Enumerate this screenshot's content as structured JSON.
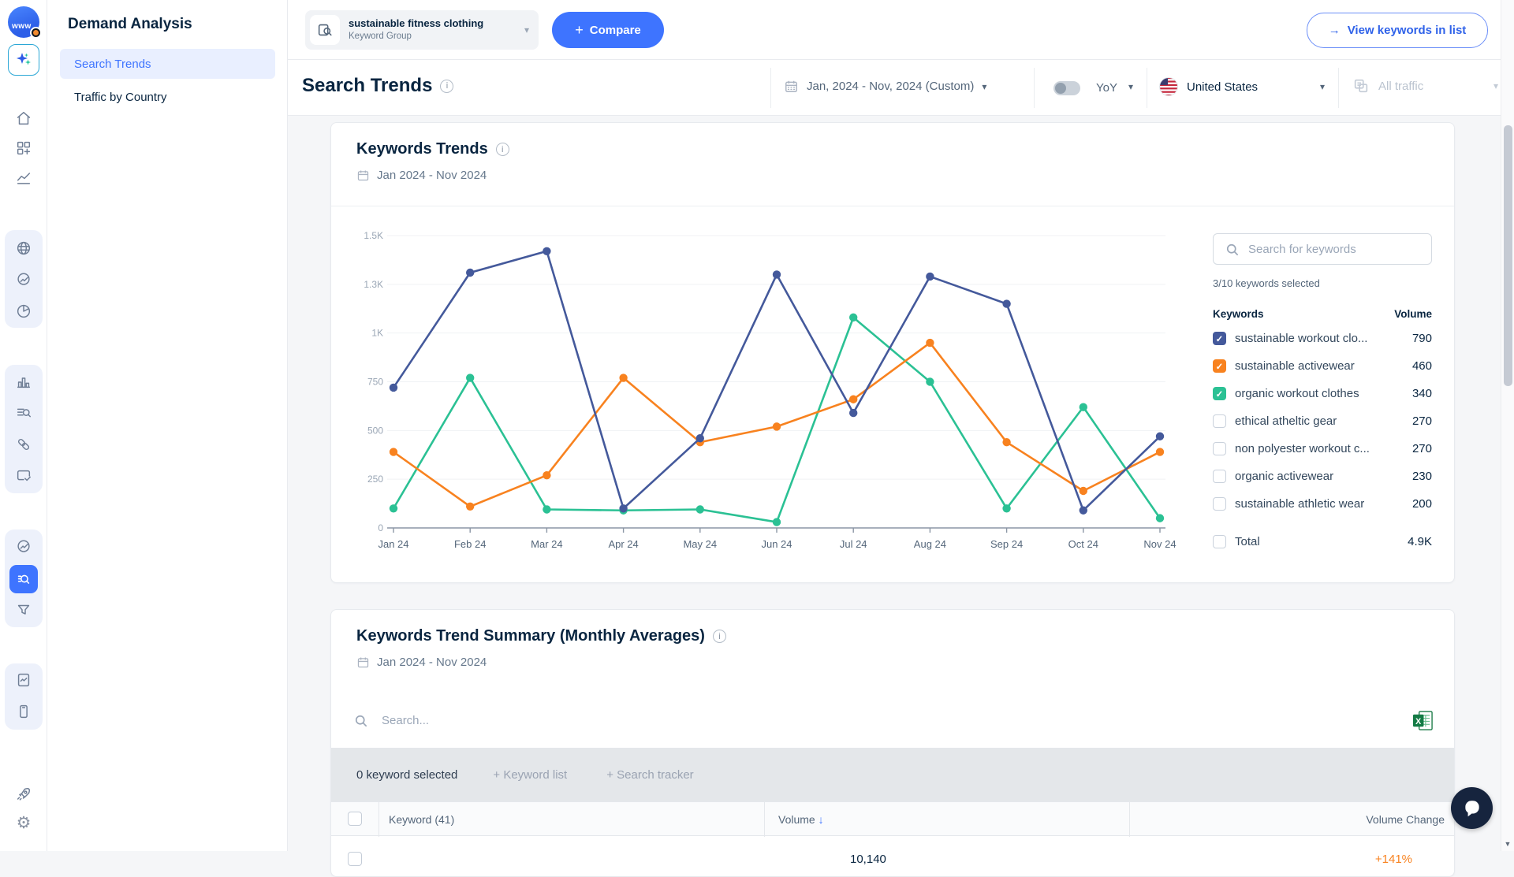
{
  "sidebar": {
    "title": "Demand Analysis",
    "items": [
      {
        "label": "Search Trends",
        "active": true
      },
      {
        "label": "Traffic by Country",
        "active": false
      }
    ]
  },
  "topbar": {
    "group_selector": {
      "name": "sustainable fitness clothing",
      "type": "Keyword Group"
    },
    "compare_label": "Compare",
    "view_keywords_label": "View keywords in list"
  },
  "header": {
    "title": "Search Trends",
    "filters": {
      "date_range": "Jan, 2024 - Nov, 2024 (Custom)",
      "yoy_label": "YoY",
      "country": "United States",
      "traffic": "All traffic"
    }
  },
  "trends_card": {
    "title": "Keywords Trends",
    "date_range": "Jan 2024 - Nov 2024",
    "search_placeholder": "Search for keywords",
    "selected_note": "3/10 keywords selected",
    "col_keywords": "Keywords",
    "col_volume": "Volume",
    "keywords": [
      {
        "label": "sustainable workout clo...",
        "volume": "790",
        "checked": true,
        "color": "#44599B"
      },
      {
        "label": "sustainable activewear",
        "volume": "460",
        "checked": true,
        "color": "#F8821F"
      },
      {
        "label": "organic workout clothes",
        "volume": "340",
        "checked": true,
        "color": "#2BC194"
      },
      {
        "label": "ethical atheltic gear",
        "volume": "270",
        "checked": false,
        "color": null
      },
      {
        "label": "non polyester workout c...",
        "volume": "270",
        "checked": false,
        "color": null
      },
      {
        "label": "organic activewear",
        "volume": "230",
        "checked": false,
        "color": null
      },
      {
        "label": "sustainable athletic wear",
        "volume": "200",
        "checked": false,
        "color": null
      }
    ],
    "total_label": "Total",
    "total_volume": "4.9K"
  },
  "chart_data": {
    "type": "line",
    "x": [
      "Jan 24",
      "Feb 24",
      "Mar 24",
      "Apr 24",
      "May 24",
      "Jun 24",
      "Jul 24",
      "Aug 24",
      "Sep 24",
      "Oct 24",
      "Nov 24"
    ],
    "ylim": [
      0,
      1500
    ],
    "yticks": [
      {
        "value": 0,
        "label": "0"
      },
      {
        "value": 250,
        "label": "250"
      },
      {
        "value": 500,
        "label": "500"
      },
      {
        "value": 750,
        "label": "750"
      },
      {
        "value": 1000,
        "label": "1K"
      },
      {
        "value": 1250,
        "label": "1.3K"
      },
      {
        "value": 1500,
        "label": "1.5K"
      }
    ],
    "grid": true,
    "legend_position": "right-panel-checkboxes",
    "series": [
      {
        "name": "organic workout clothes",
        "color": "#2BC194",
        "values": [
          100,
          770,
          95,
          90,
          95,
          30,
          1080,
          750,
          100,
          620,
          50
        ]
      },
      {
        "name": "sustainable activewear",
        "color": "#F8821F",
        "values": [
          390,
          110,
          270,
          770,
          440,
          520,
          660,
          950,
          440,
          190,
          390
        ]
      },
      {
        "name": "sustainable workout clothes",
        "color": "#44599B",
        "values": [
          720,
          1310,
          1420,
          100,
          460,
          1300,
          590,
          1290,
          1150,
          90,
          470
        ]
      }
    ]
  },
  "summary_card": {
    "title": "Keywords Trend Summary (Monthly Averages)",
    "date_range": "Jan 2024 - Nov 2024",
    "search_placeholder": "Search...",
    "toolbar": {
      "selected": "0 keyword selected",
      "keyword_list": "+ Keyword list",
      "search_tracker": "+ Search tracker"
    },
    "table": {
      "col_keyword": "Keyword (41)",
      "col_volume": "Volume",
      "col_volume_change": "Volume Change",
      "partial_row": {
        "volume": "10,140",
        "volume_change": "+141%"
      }
    }
  },
  "icons": {
    "accent_color": "#3E74FF",
    "names": [
      "sparkle-icon",
      "home-icon",
      "dashboard-add-icon",
      "trend-icon",
      "globe-icon",
      "web-analysis-icon",
      "pie-icon",
      "bar-chart-icon",
      "search-list-icon",
      "link-icon",
      "card-check-icon",
      "search-intelligence-icon",
      "funnel-icon",
      "report-icon",
      "mobile-icon",
      "rocket-icon",
      "gear-icon",
      "calendar-icon",
      "info-icon",
      "search-icon",
      "us-flag-icon",
      "channels-icon",
      "excel-export-icon",
      "chat-icon"
    ]
  }
}
